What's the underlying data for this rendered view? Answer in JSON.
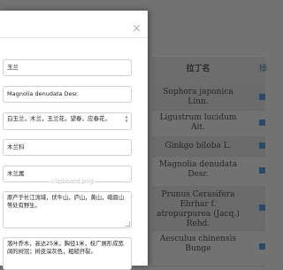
{
  "modal": {
    "close_glyph": "×",
    "fields": {
      "chinese_name": "玉兰",
      "scientific_name": "Magnolia denudata Desr.",
      "aliases": "白玉兰，木兰，玉兰花，望春，应春花，",
      "family": "木兰科",
      "genus": "木兰属",
      "distribution": "原产于长江流域，伏牛山，庐山，黄山，峨眉山等处有野生。",
      "morphology": "落叶乔木，高达25米，胸径1米，枝广展形成宽阔的树冠；树皮深灰色，粗糙开裂。"
    },
    "clipboard_label": "clipboard.png",
    "scroll_up_glyph": "▲",
    "scroll_down_glyph": "▼"
  },
  "background_table": {
    "column_header": "拉丁名",
    "column_header_next": "操",
    "rows": [
      "Sophora japonica Linn.",
      "Ligustrum lucidum Ait.",
      "Ginkgo biloba L.",
      "Magnolia denudata Desr.",
      "Prunus Cerasifera Ehrhar f. atropurpurea (Jacq.) Rehd.",
      "Aesculus chinensis Bunge"
    ]
  },
  "colors": {
    "overlay": "#727272",
    "modal_bg": "#ffffff",
    "field_border": "#d0d0d0",
    "link": "#2c4a66"
  }
}
